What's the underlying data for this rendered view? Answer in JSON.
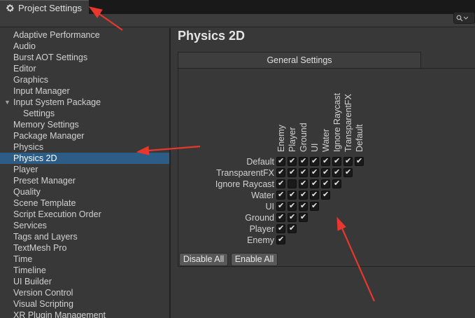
{
  "window": {
    "title": "Project Settings",
    "icon": "gear-icon"
  },
  "search": {
    "icon": "search-icon",
    "dropdown_icon": "chevron-down-icon"
  },
  "sidebar": {
    "items": [
      {
        "label": "Adaptive Performance"
      },
      {
        "label": "Audio"
      },
      {
        "label": "Burst AOT Settings"
      },
      {
        "label": "Editor"
      },
      {
        "label": "Graphics"
      },
      {
        "label": "Input Manager"
      },
      {
        "label": "Input System Package",
        "expanded": true
      },
      {
        "label": "Settings",
        "child": true
      },
      {
        "label": "Memory Settings"
      },
      {
        "label": "Package Manager"
      },
      {
        "label": "Physics"
      },
      {
        "label": "Physics 2D",
        "selected": true
      },
      {
        "label": "Player"
      },
      {
        "label": "Preset Manager"
      },
      {
        "label": "Quality"
      },
      {
        "label": "Scene Template"
      },
      {
        "label": "Script Execution Order"
      },
      {
        "label": "Services"
      },
      {
        "label": "Tags and Layers"
      },
      {
        "label": "TextMesh Pro"
      },
      {
        "label": "Time"
      },
      {
        "label": "Timeline"
      },
      {
        "label": "UI Builder"
      },
      {
        "label": "Version Control"
      },
      {
        "label": "Visual Scripting"
      },
      {
        "label": "XR Plugin Management"
      }
    ]
  },
  "main": {
    "title": "Physics 2D",
    "section_tab": "General Settings",
    "matrix": {
      "columns": [
        "Enemy",
        "Player",
        "Ground",
        "UI",
        "Water",
        "Ignore Raycast",
        "TransparentFX",
        "Default"
      ],
      "rows": [
        {
          "label": "Default",
          "checks": [
            true,
            true,
            true,
            true,
            true,
            true,
            true,
            true
          ]
        },
        {
          "label": "TransparentFX",
          "checks": [
            true,
            true,
            true,
            true,
            true,
            true,
            true
          ]
        },
        {
          "label": "Ignore Raycast",
          "checks": [
            true,
            false,
            true,
            true,
            true,
            true
          ]
        },
        {
          "label": "Water",
          "checks": [
            true,
            true,
            true,
            true,
            true
          ]
        },
        {
          "label": "UI",
          "checks": [
            true,
            true,
            true,
            true
          ]
        },
        {
          "label": "Ground",
          "checks": [
            true,
            true,
            true
          ]
        },
        {
          "label": "Player",
          "checks": [
            true,
            true
          ]
        },
        {
          "label": "Enemy",
          "checks": [
            true
          ]
        }
      ]
    },
    "buttons": {
      "disable_all": "Disable All",
      "enable_all": "Enable All"
    }
  },
  "colors": {
    "accent_selected": "#2c5d87",
    "annotation_arrow": "#e8372c"
  }
}
